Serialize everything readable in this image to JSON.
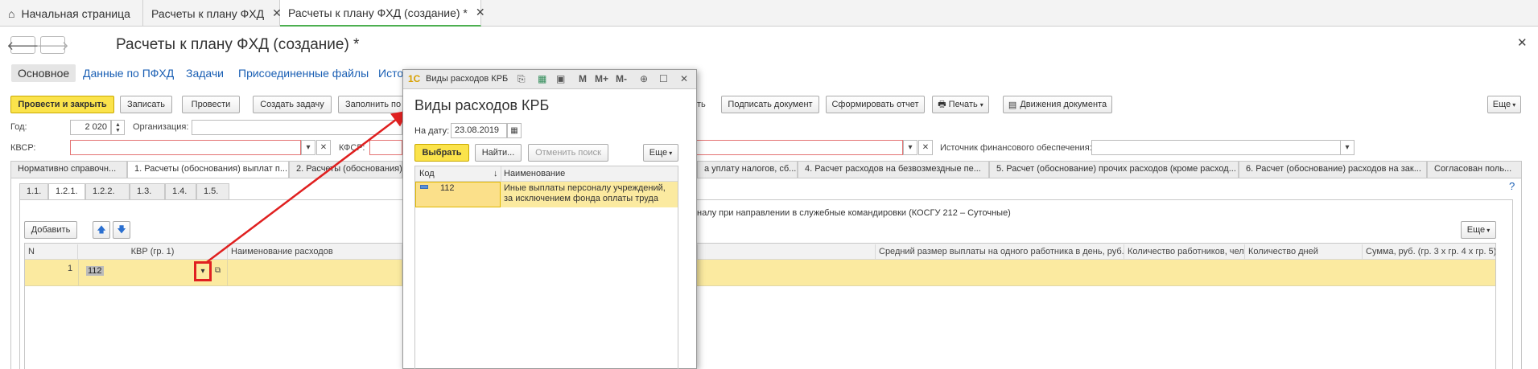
{
  "window_tabs": [
    {
      "label": "Начальная страница"
    },
    {
      "label": "Расчеты к плану ФХД"
    },
    {
      "label": "Расчеты к плану ФХД (создание) *"
    }
  ],
  "form": {
    "title": "Расчеты к плану ФХД (создание) *",
    "sections": [
      "Основное",
      "Данные по ПФХД",
      "Задачи",
      "Присоединенные файлы",
      "Исто"
    ],
    "toolbar": {
      "post_close": "Провести и закрыть",
      "save": "Записать",
      "post": "Провести",
      "create_task": "Создать задачу",
      "fill": "Заполнить по",
      "suffix": "ть",
      "sign": "Подписать документ",
      "report": "Сформировать отчет",
      "print": "Печать",
      "movements": "Движения документа",
      "more": "Еще"
    },
    "fields": {
      "year_label": "Год:",
      "year_value": "2 020",
      "org_label": "Организация:",
      "kvsr_label": "КВСР:",
      "kfsr_label": "КФСР:",
      "source_label": "Источник финансового обеспечения:"
    },
    "calc_tabs": [
      "Нормативно справочн...",
      "1. Расчеты (обоснования) выплат п...",
      "2. Расчеты (обоснования)",
      "а уплату налогов, сб...",
      "4. Расчет расходов на безвозмездные пе...",
      "5. Расчет (обоснование) прочих расходов (кроме расход...",
      "6. Расчет (обоснование) расходов на зак...",
      "Согласован поль..."
    ],
    "sub_tabs": [
      "1.1.",
      "1.2.1.",
      "1.2.2.",
      "1.3.",
      "1.4.",
      "1.5."
    ],
    "help": "?",
    "description": "налу при направлении в служебные командировки (КОСГУ 212 – Суточные)",
    "add_button": "Добавить",
    "table": {
      "headers": [
        "N",
        "КВР (гр. 1)",
        "Наименование расходов",
        "Средний размер выплаты на одного работника в день, руб.",
        "Количество работников, чел.",
        "Количество дней",
        "Сумма, руб. (гр. 3 х гр. 4 х гр. 5)"
      ],
      "rows": [
        {
          "n": "1",
          "kvr": "112"
        }
      ]
    }
  },
  "modal": {
    "window_title": "Виды расходов КРБ",
    "heading": "Виды расходов КРБ",
    "date_label": "На дату:",
    "date_value": "23.08.2019",
    "select_button": "Выбрать",
    "find_button": "Найти...",
    "cancel_search_button": "Отменить поиск",
    "more_button": "Еще",
    "toolbar_icons": {
      "m": "M",
      "mplus": "M+",
      "mminus": "M-"
    },
    "columns": {
      "code": "Код",
      "name": "Наименование"
    },
    "rows": [
      {
        "code": "112",
        "name_line1": "Иные выплаты персоналу учреждений,",
        "name_line2": "за исключением фонда оплаты труда"
      }
    ]
  },
  "colors": {
    "primary_button": "#fbe34b",
    "link": "#1a5fb4",
    "selection": "#fbeaa0",
    "annotation": "#e02020"
  }
}
